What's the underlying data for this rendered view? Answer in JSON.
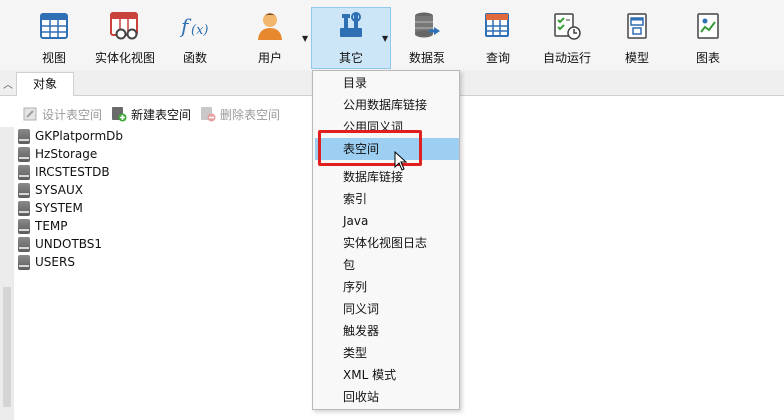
{
  "toolbar": {
    "buttons": [
      {
        "label": "视图",
        "icon": "table-view-icon"
      },
      {
        "label": "实体化视图",
        "icon": "materialized-view-icon"
      },
      {
        "label": "函数",
        "icon": "function-fx-icon"
      },
      {
        "label": "用户",
        "icon": "user-icon"
      },
      {
        "label": "其它",
        "icon": "tools-icon"
      },
      {
        "label": "数据泵",
        "icon": "data-pump-icon"
      },
      {
        "label": "查询",
        "icon": "query-icon"
      },
      {
        "label": "自动运行",
        "icon": "auto-run-icon"
      },
      {
        "label": "模型",
        "icon": "model-icon"
      },
      {
        "label": "图表",
        "icon": "chart-icon"
      }
    ],
    "active": "其它"
  },
  "tab": {
    "label": "对象"
  },
  "object_toolbar": {
    "design": "设计表空间",
    "new": "新建表空间",
    "delete": "删除表空间"
  },
  "tablespaces": [
    "GKPlatpormDb",
    "HzStorage",
    "IRCSTESTDB",
    "SYSAUX",
    "SYSTEM",
    "TEMP",
    "UNDOTBS1",
    "USERS"
  ],
  "menu": {
    "items": [
      "目录",
      "公用数据库链接",
      "公用同义词",
      "表空间",
      "数据库链接",
      "索引",
      "Java",
      "实体化视图日志",
      "包",
      "序列",
      "同义词",
      "触发器",
      "类型",
      "XML 模式",
      "回收站"
    ],
    "hovered": "表空间"
  },
  "colors": {
    "accent": "#9dcff2",
    "highlight": "#e02020",
    "active_button": "#cde6f7"
  }
}
